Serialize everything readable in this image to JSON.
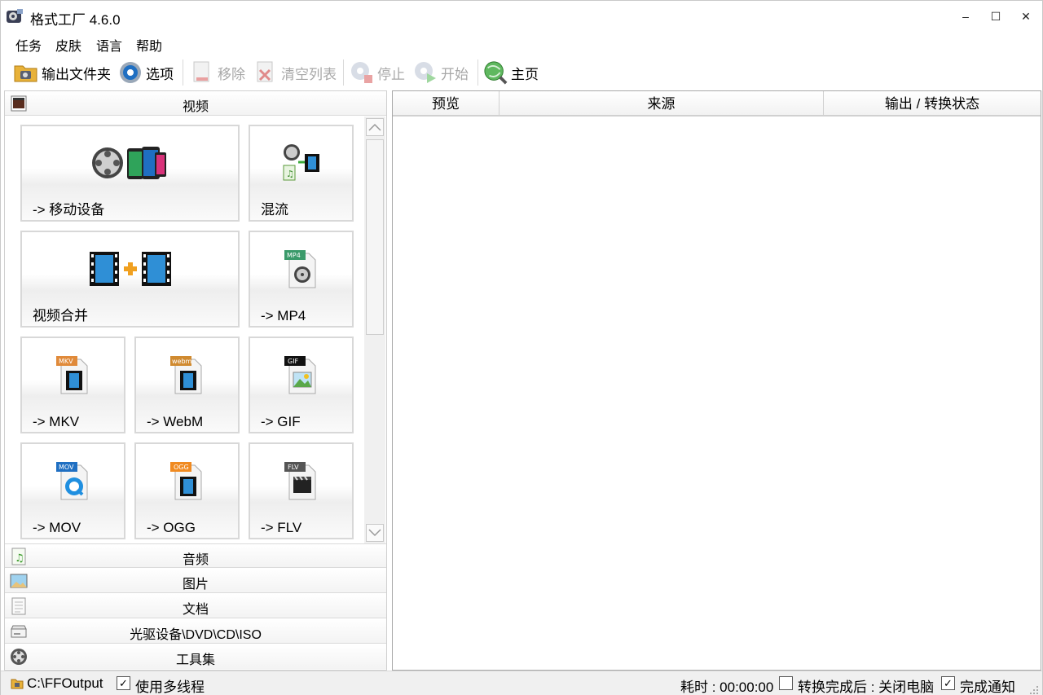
{
  "app": {
    "title": "格式工厂 4.6.0"
  },
  "window": {
    "minimize": "–",
    "maximize": "☐",
    "close": "✕"
  },
  "menu": [
    "任务",
    "皮肤",
    "语言",
    "帮助"
  ],
  "toolbar": {
    "output_folder": "输出文件夹",
    "options": "选项",
    "remove": "移除",
    "clear_list": "清空列表",
    "stop": "停止",
    "start": "开始",
    "home": "主页"
  },
  "categories": {
    "video": "视频",
    "audio": "音频",
    "picture": "图片",
    "document": "文档",
    "rom": "光驱设备\\DVD\\CD\\ISO",
    "tools": "工具集"
  },
  "tiles": [
    {
      "label": "-> 移动设备",
      "icon": "mobile-device-icon"
    },
    {
      "label": "混流",
      "icon": "mux-icon"
    },
    {
      "label": "视频合并",
      "icon": "video-join-icon"
    },
    {
      "label": "-> MP4",
      "icon": "mp4-file-icon",
      "tag": "MP4"
    },
    {
      "label": "-> MKV",
      "icon": "mkv-file-icon",
      "tag": "MKV"
    },
    {
      "label": "-> WebM",
      "icon": "webm-file-icon",
      "tag": "webm"
    },
    {
      "label": "-> GIF",
      "icon": "gif-file-icon",
      "tag": "GIF"
    },
    {
      "label": "-> MOV",
      "icon": "mov-file-icon",
      "tag": "MOV"
    },
    {
      "label": "-> OGG",
      "icon": "ogg-file-icon",
      "tag": "OGG"
    },
    {
      "label": "-> FLV",
      "icon": "flv-file-icon",
      "tag": "FLV"
    }
  ],
  "table": {
    "columns": [
      "预览",
      "来源",
      "输出 / 转换状态"
    ]
  },
  "status": {
    "output_path": "C:\\FFOutput",
    "multithread": "使用多线程",
    "multithread_checked": true,
    "elapsed": "耗时 : 00:00:00",
    "after_done": "转换完成后 : 关闭电脑",
    "after_done_checked": false,
    "notify": "完成通知",
    "notify_checked": true
  },
  "colors": {
    "accent_blue": "#1f6fc2",
    "disabled_text": "#a8a8a8"
  }
}
